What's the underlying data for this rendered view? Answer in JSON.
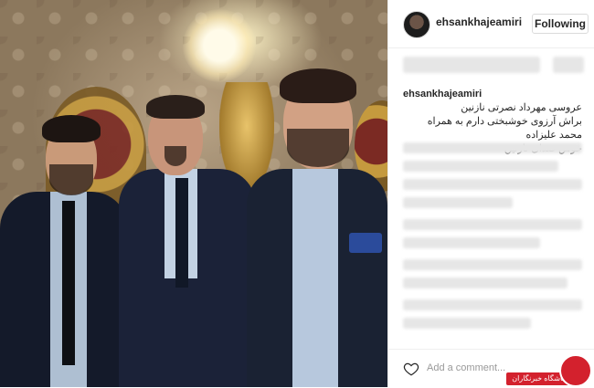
{
  "post": {
    "username": "ehsankhajeamiri",
    "follow_label": "Following",
    "caption": {
      "username": "ehsankhajeamiri",
      "lines": [
        "عروسی مهرداد نصرتی نازنین",
        "براش آرزوی خوشبختی دارم به همراه محمد علیزاده",
        "خوش صدای نازنین"
      ]
    },
    "comment_placeholder": "Add a comment..."
  },
  "watermark": {
    "text": "باشگاه خبرنگاران"
  },
  "colors": {
    "accent_red": "#d3212d",
    "border": "#dbdbdb",
    "text": "#262626",
    "muted": "#999999"
  },
  "icons": {
    "like": "heart-icon",
    "logo": "news-club-logo-icon"
  }
}
